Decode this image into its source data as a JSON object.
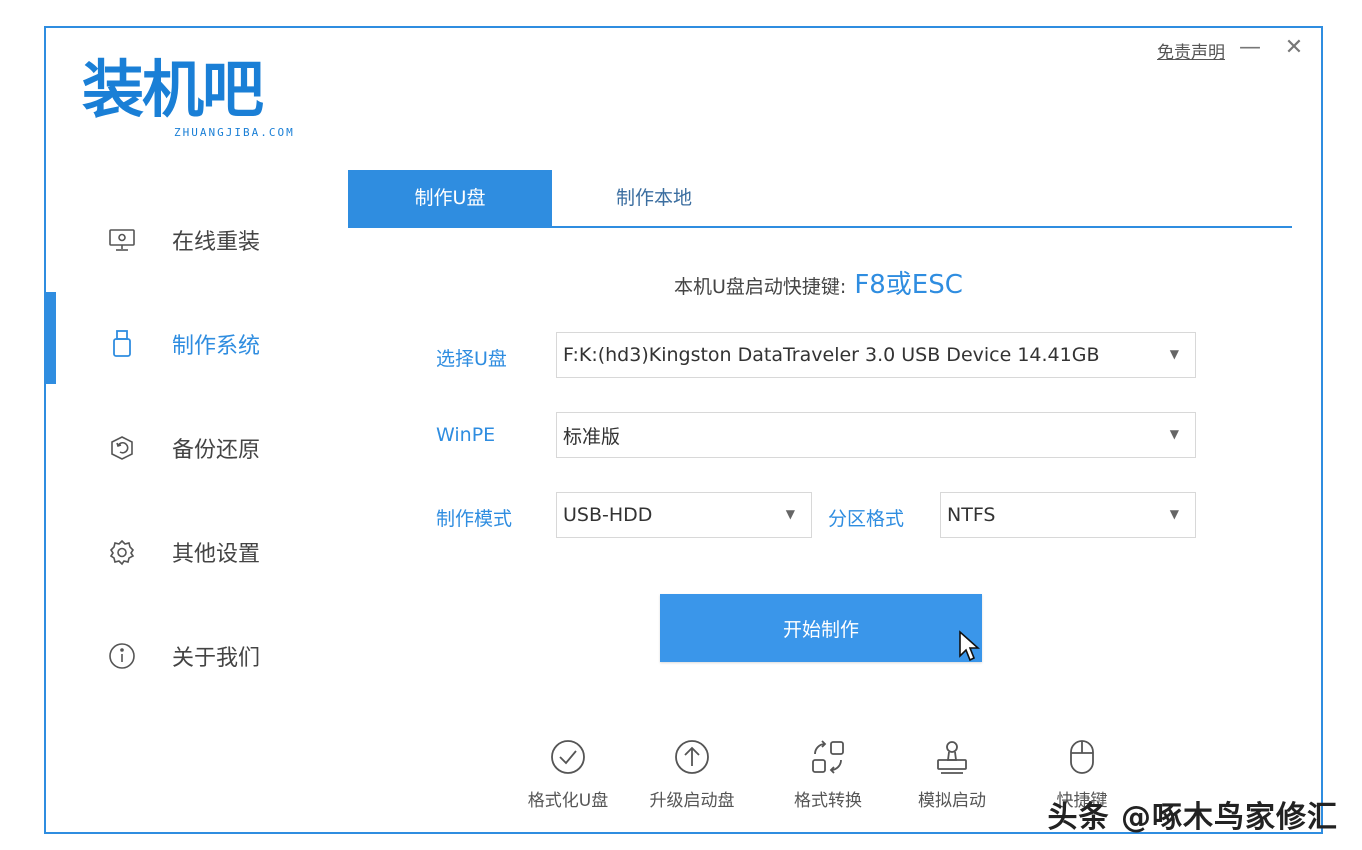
{
  "app": {
    "logo_text": "装机吧",
    "logo_subtext": "ZHUANGJIBA.COM",
    "disclaimer": "免责声明",
    "minimize_glyph": "—",
    "close_glyph": "✕"
  },
  "sidebar": {
    "items": [
      {
        "label": "在线重装",
        "icon": "monitor-icon",
        "active": false
      },
      {
        "label": "制作系统",
        "icon": "usb-drive-icon",
        "active": true
      },
      {
        "label": "备份还原",
        "icon": "backup-icon",
        "active": false
      },
      {
        "label": "其他设置",
        "icon": "gear-icon",
        "active": false
      },
      {
        "label": "关于我们",
        "icon": "info-icon",
        "active": false
      }
    ]
  },
  "tabs": [
    {
      "label": "制作U盘",
      "active": true
    },
    {
      "label": "制作本地",
      "active": false
    }
  ],
  "hotkey": {
    "label": "本机U盘启动快捷键:",
    "value": "F8或ESC"
  },
  "form": {
    "usb_label": "选择U盘",
    "usb_value": "F:K:(hd3)Kingston DataTraveler 3.0 USB Device 14.41GB",
    "winpe_label": "WinPE",
    "winpe_value": "标准版",
    "mode_label": "制作模式",
    "mode_value": "USB-HDD",
    "partition_label": "分区格式",
    "partition_value": "NTFS"
  },
  "start_button": "开始制作",
  "tools": [
    {
      "label": "格式化U盘",
      "icon": "check-circle-icon"
    },
    {
      "label": "升级启动盘",
      "icon": "arrow-up-circle-icon"
    },
    {
      "label": "格式转换",
      "icon": "convert-icon"
    },
    {
      "label": "模拟启动",
      "icon": "stamp-icon"
    },
    {
      "label": "快捷键",
      "icon": "mouse-icon"
    }
  ],
  "watermark": "头条 @啄木鸟家修汇",
  "colors": {
    "accent": "#2f8de0",
    "button": "#3a96ea"
  }
}
